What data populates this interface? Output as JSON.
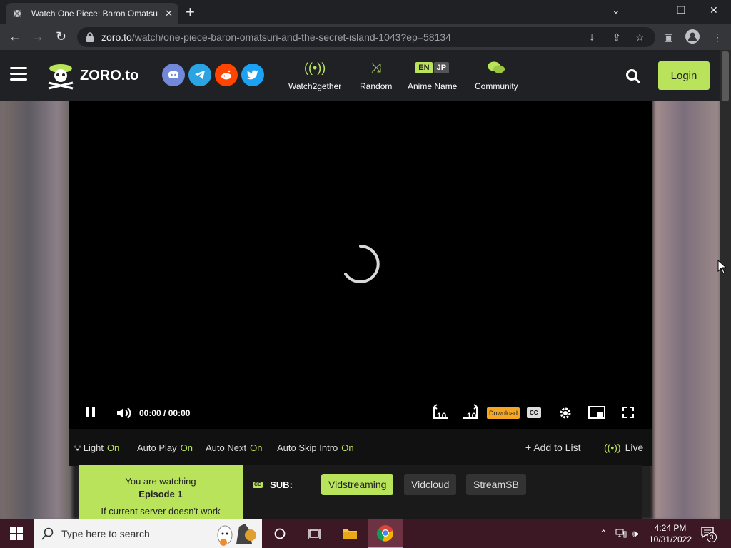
{
  "browser": {
    "tab_title": "Watch One Piece: Baron Omatsuri",
    "tab_close": "✕",
    "new_tab": "+",
    "url_host": "zoro.to",
    "url_path": "/watch/one-piece-baron-omatsuri-and-the-secret-island-1043?ep=58134"
  },
  "site": {
    "logo_text": "ZORO.to",
    "social": [
      {
        "name": "discord",
        "color": "#7289da",
        "glyph": "◉"
      },
      {
        "name": "telegram",
        "color": "#2aa4e3",
        "glyph": "➤"
      },
      {
        "name": "reddit",
        "color": "#ff4500",
        "glyph": "●"
      },
      {
        "name": "twitter",
        "color": "#1da1f2",
        "glyph": "✦"
      }
    ],
    "nav": {
      "watch2gether": "Watch2gether",
      "random": "Random",
      "anime_name": "Anime Name",
      "community": "Community",
      "lang_en": "EN",
      "lang_jp": "JP"
    },
    "login": "Login",
    "accent_color": "#b9e35a"
  },
  "player": {
    "current_time": "00:00",
    "separator": "/",
    "duration": "00:00",
    "download_label": "Download",
    "cc_label": "CC",
    "rewind_label": "10",
    "forward_label": "10"
  },
  "toggles": {
    "light": "Light",
    "light_state": "On",
    "autoplay": "Auto Play",
    "autoplay_state": "On",
    "autonext": "Auto Next",
    "autonext_state": "On",
    "autoskip": "Auto Skip Intro",
    "autoskip_state": "On",
    "add_to_list": "Add to List",
    "live": "Live"
  },
  "servers": {
    "watching_line1": "You are watching",
    "episode": "Episode 1",
    "watching_line3": "If current server doesn't work",
    "sub_label": "SUB:",
    "sub_badge": "CC",
    "options": [
      "Vidstreaming",
      "Vidcloud",
      "StreamSB"
    ]
  },
  "taskbar": {
    "search_placeholder": "Type here to search",
    "time": "4:24 PM",
    "date": "10/31/2022",
    "notifications": "3"
  }
}
